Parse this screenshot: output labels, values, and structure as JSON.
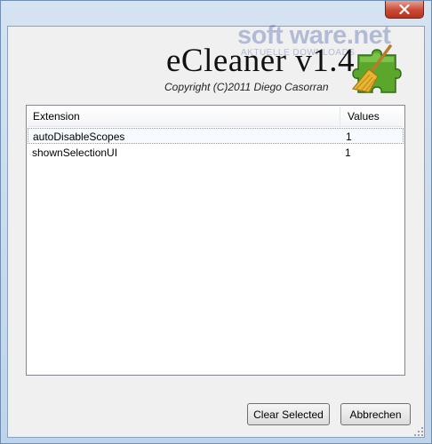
{
  "titlebar": {
    "close_label": "x"
  },
  "header": {
    "title": "eCleaner v1.4",
    "copyright": "Copyright (C)2011 Diego Casorran",
    "watermark": "soft ware.net",
    "watermark_sub": "AKTUELLE DOWNLOADS"
  },
  "list": {
    "columns": [
      "Extension",
      "Values"
    ],
    "rows": [
      {
        "extension": "autoDisableScopes",
        "value": "1"
      },
      {
        "extension": "shownSelectionUI",
        "value": "1"
      }
    ]
  },
  "buttons": {
    "clear_selected": "Clear Selected",
    "cancel": "Abbrechen"
  },
  "colors": {
    "frame": "#c7d9ec",
    "close": "#c74a34",
    "logo_green": "#5aa72c",
    "broom": "#e8b530"
  },
  "icons": {
    "close": "close-icon",
    "logo": "puzzle-broom-icon"
  }
}
